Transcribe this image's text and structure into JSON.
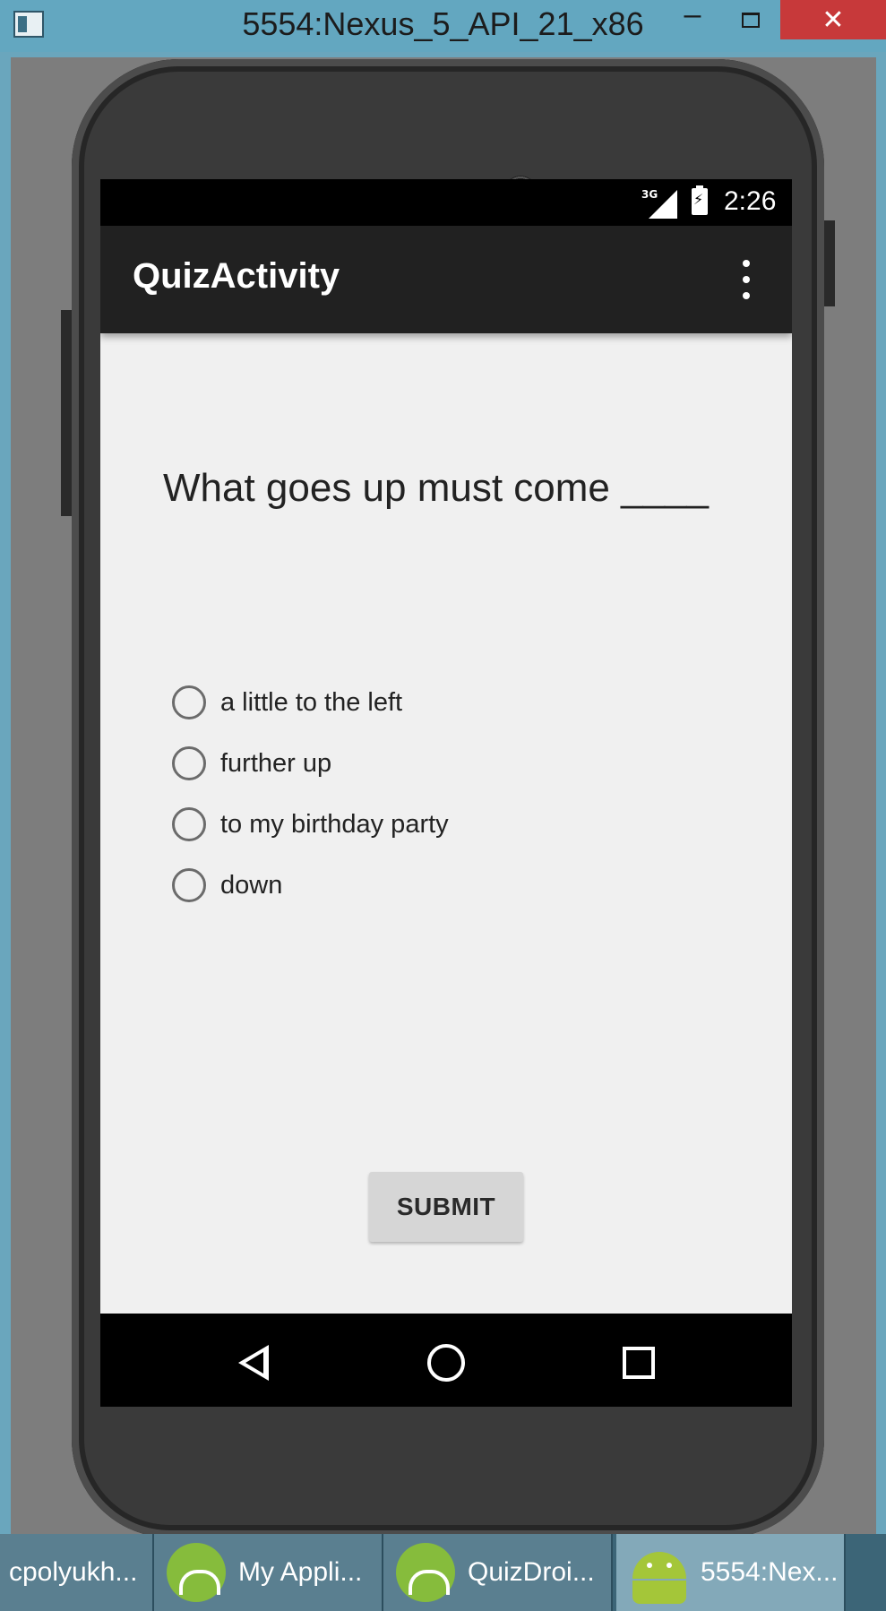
{
  "window": {
    "title": "5554:Nexus_5_API_21_x86",
    "minimize": "–",
    "close": "✕"
  },
  "status_bar": {
    "network": "3G",
    "time": "2:26"
  },
  "app": {
    "title": "QuizActivity"
  },
  "quiz": {
    "question": "What goes up must come ____",
    "options": [
      "a little to the left",
      "further up",
      "to my birthday party",
      "down"
    ],
    "submit_label": "SUBMIT"
  },
  "taskbar": {
    "items": [
      "cpolyukh...",
      "My Appli...",
      "QuizDroi...",
      "5554:Nex..."
    ]
  }
}
